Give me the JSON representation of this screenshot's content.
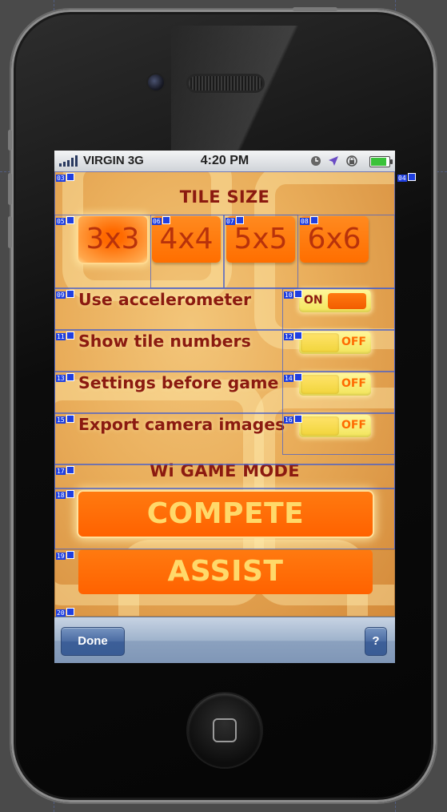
{
  "status_bar": {
    "carrier": "VIRGIN 3G",
    "time": "4:20 PM",
    "signal_bars": 5,
    "battery_level": 0.85
  },
  "settings": {
    "tile_size": {
      "title": "TILE SIZE",
      "options": [
        "3x3",
        "4x4",
        "5x5",
        "6x6"
      ],
      "selected": "3x3"
    },
    "toggles": [
      {
        "label": "Use accelerometer",
        "state": "ON"
      },
      {
        "label": "Show tile numbers",
        "state": "OFF"
      },
      {
        "label": "Settings before game",
        "state": "OFF"
      },
      {
        "label": "Export camera images",
        "state": "OFF"
      }
    ],
    "game_mode": {
      "title": "Wi GAME MODE",
      "buttons": [
        "COMPETE",
        "ASSIST"
      ]
    }
  },
  "toolbar": {
    "done_label": "Done",
    "help_label": "?"
  },
  "annotations": [
    "03",
    "04",
    "05",
    "06",
    "07",
    "08",
    "09",
    "10",
    "11",
    "12",
    "13",
    "14",
    "15",
    "16",
    "17",
    "18",
    "19",
    "20"
  ],
  "colors": {
    "accent_orange": "#ff6e00",
    "label_red": "#8b1a10",
    "toggle_yellow": "#fff69a",
    "toolbar_blue": "#3a5c95"
  }
}
